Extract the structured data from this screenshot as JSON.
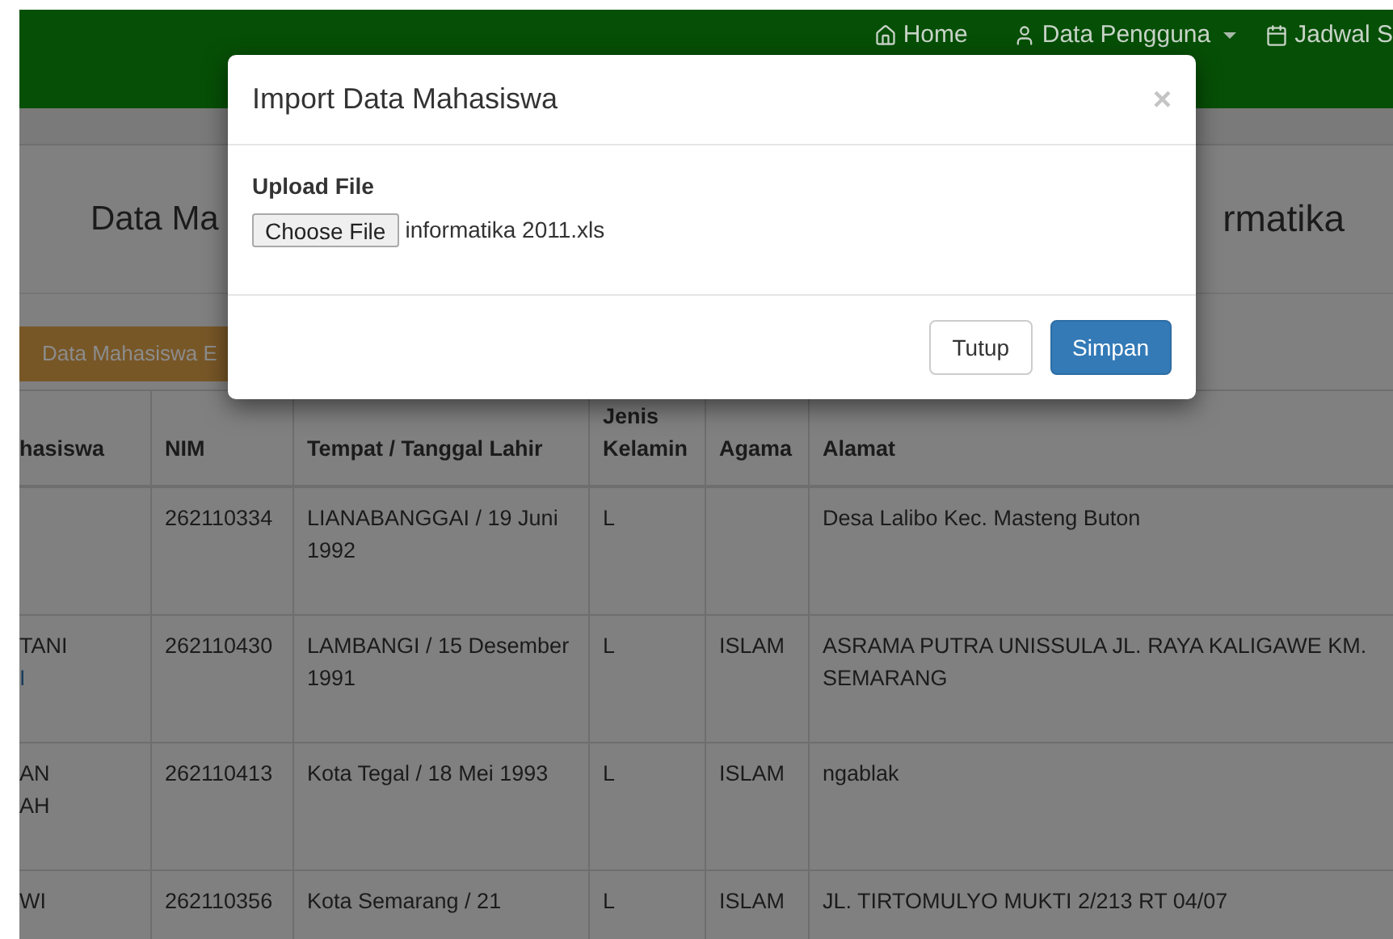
{
  "navbar": {
    "items": [
      {
        "label": "Home",
        "dropdown": false
      },
      {
        "label": "Data Pengguna",
        "dropdown": true
      },
      {
        "label": "Jadwal S",
        "dropdown": false
      }
    ]
  },
  "page": {
    "heading_left": "Data Ma",
    "heading_right": "rmatika",
    "action_button": "Data Mahasiswa E"
  },
  "table": {
    "columns": [
      "hasiswa",
      "NIM",
      "Tempat / Tanggal Lahir",
      "Jenis Kelamin",
      "Agama",
      "Alamat"
    ],
    "rows": [
      {
        "cells": [
          "",
          "262110334",
          "LIANABANGGAI / 19 Juni 1992",
          "L",
          "",
          "Desa Lalibo Kec. Masteng Buton"
        ]
      },
      {
        "cells": [
          "TANI",
          "262110430",
          "LAMBANGI / 15 Desember 1991",
          "L",
          "ISLAM",
          "ASRAMA PUTRA UNISSULA JL. RAYA KALIGAWE KM. SEMARANG"
        ],
        "link": "I"
      },
      {
        "cells": [
          "AN\nAH",
          "262110413",
          "Kota Tegal / 18 Mei 1993",
          "L",
          "ISLAM",
          "ngablak"
        ]
      },
      {
        "cells": [
          "WI",
          "262110356",
          "Kota Semarang / 21",
          "L",
          "ISLAM",
          "JL. TIRTOMULYO MUKTI 2/213 RT 04/07"
        ]
      }
    ]
  },
  "modal": {
    "title": "Import Data Mahasiswa",
    "close": "×",
    "field_label": "Upload File",
    "file_button": "Choose File",
    "file_name": "informatika 2011.xls",
    "buttons": [
      {
        "label": "Tutup",
        "kind": "default"
      },
      {
        "label": "Simpan",
        "kind": "primary"
      }
    ]
  }
}
